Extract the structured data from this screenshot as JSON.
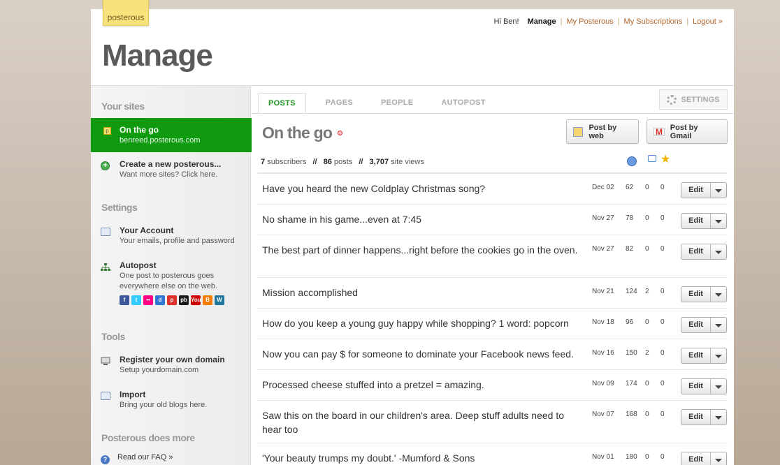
{
  "brand": {
    "logo_text": "posterous"
  },
  "topnav": {
    "greeting": "Hi Ben!",
    "manage": "Manage",
    "my_posterous": "My Posterous",
    "my_subscriptions": "My Subscriptions",
    "logout": "Logout »"
  },
  "page_title": "Manage",
  "sidebar": {
    "your_sites_title": "Your sites",
    "active_site": {
      "name": "On the go",
      "domain": "benreed.posterous.com",
      "icon": "posterous-p-icon"
    },
    "create_site": {
      "title": "Create a new posterous...",
      "desc": "Want more sites? Click here."
    },
    "settings_title": "Settings",
    "account": {
      "title": "Your Account",
      "desc": "Your emails, profile and password"
    },
    "autopost": {
      "title": "Autopost",
      "desc1": "One post to posterous goes",
      "desc2": "everywhere else on the web."
    },
    "social_icons": [
      {
        "name": "facebook-icon",
        "glyph": "f",
        "color": "#3b5998"
      },
      {
        "name": "twitter-icon",
        "glyph": "t",
        "color": "#33ccff"
      },
      {
        "name": "flickr-icon",
        "glyph": "••",
        "color": "#ff0084"
      },
      {
        "name": "delicious-icon",
        "glyph": "d",
        "color": "#3274d1"
      },
      {
        "name": "picasa-icon",
        "glyph": "p",
        "color": "#e0302a"
      },
      {
        "name": "photobucket-icon",
        "glyph": "pb",
        "color": "#1a1a1a"
      },
      {
        "name": "youtube-icon",
        "glyph": "You",
        "color": "#cc0000"
      },
      {
        "name": "blogger-icon",
        "glyph": "B",
        "color": "#f57d00"
      },
      {
        "name": "wordpress-icon",
        "glyph": "W",
        "color": "#21759b"
      }
    ],
    "tools_title": "Tools",
    "domain": {
      "title": "Register your own domain",
      "desc": "Setup yourdomain.com"
    },
    "import": {
      "title": "Import",
      "desc": "Bring your old blogs here."
    },
    "more_title": "Posterous does more",
    "faq": "Read our FAQ »"
  },
  "tabs": [
    {
      "label": "POSTS",
      "active": true
    },
    {
      "label": "PAGES",
      "active": false
    },
    {
      "label": "PEOPLE",
      "active": false
    },
    {
      "label": "AUTOPOST",
      "active": false
    }
  ],
  "settings_label": "SETTINGS",
  "site_title": "On the go",
  "post_by_web": "Post by web",
  "post_by_gmail": "Post by Gmail",
  "stats": {
    "subscribers": "7",
    "subscribers_label": "subscribers",
    "posts": "86",
    "posts_label": "posts",
    "views": "3,707",
    "views_label": "site views",
    "sep": "//"
  },
  "edit_label": "Edit",
  "posts": [
    {
      "title": "Have you heard the new Coldplay Christmas song?",
      "date": "Dec 02",
      "views": "62",
      "c1": "0",
      "c2": "0"
    },
    {
      "title": "No shame in his game...even at 7:45",
      "date": "Nov 27",
      "views": "78",
      "c1": "0",
      "c2": "0"
    },
    {
      "title": "The best part of dinner happens...right before the cookies go in the oven.",
      "date": "Nov 27",
      "views": "82",
      "c1": "0",
      "c2": "0"
    },
    {
      "title": "Mission accomplished",
      "date": "Nov 21",
      "views": "124",
      "c1": "2",
      "c2": "0"
    },
    {
      "title": "How do you keep a young guy happy while shopping? 1 word: popcorn",
      "date": "Nov 18",
      "views": "96",
      "c1": "0",
      "c2": "0"
    },
    {
      "title": "Now you can pay $ for someone to dominate your Facebook news feed.",
      "date": "Nov 16",
      "views": "150",
      "c1": "2",
      "c2": "0"
    },
    {
      "title": "Processed cheese stuffed into a pretzel = amazing.",
      "date": "Nov 09",
      "views": "174",
      "c1": "0",
      "c2": "0"
    },
    {
      "title": "Saw this on the board in our children's area. Deep stuff adults need to hear too",
      "date": "Nov 07",
      "views": "168",
      "c1": "0",
      "c2": "0"
    },
    {
      "title": "'Your beauty trumps my doubt.' -Mumford & Sons",
      "date": "Nov 01",
      "views": "180",
      "c1": "0",
      "c2": "0"
    }
  ]
}
